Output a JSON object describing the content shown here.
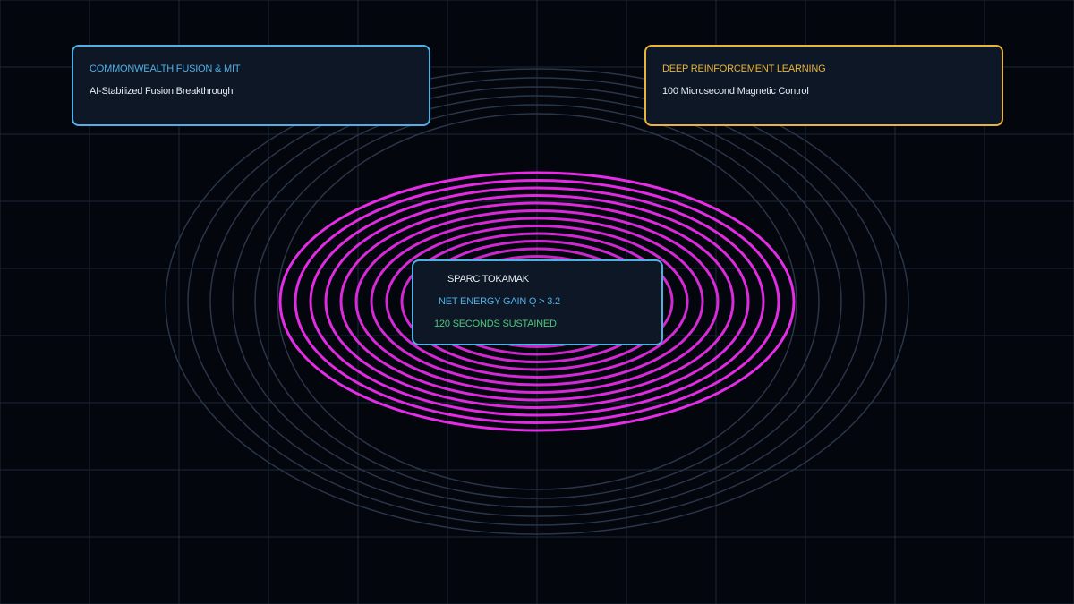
{
  "colors": {
    "background": "#03060d",
    "grid": "#1c2738",
    "outer_rings": "#2a3548",
    "plasma_rings": "#e62ce6",
    "card_fill": "#0e1726",
    "blue_accent": "#4fb0e6",
    "gold_accent": "#e8b43a",
    "green_text": "#49c97a",
    "white_text": "#e6ecf4"
  },
  "cards": {
    "left": {
      "heading": "COMMONWEALTH FUSION & MIT",
      "subtitle": "AI-Stabilized Fusion Breakthrough"
    },
    "right": {
      "heading": "DEEP REINFORCEMENT LEARNING",
      "subtitle": "100 Microsecond Magnetic Control"
    },
    "center": {
      "title": "SPARC TOKAMAK",
      "metric": "NET ENERGY GAIN Q > 3.2",
      "duration": "120 SECONDS SUSTAINED"
    }
  }
}
